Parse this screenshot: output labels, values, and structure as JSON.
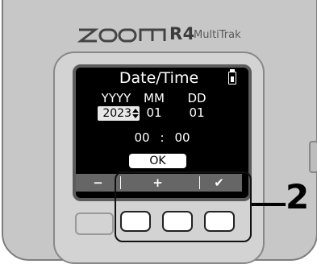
{
  "device": {
    "brand_logo": "ZOOM",
    "model": "R4",
    "subtitle": "MultiTrak"
  },
  "screen": {
    "title": "Date/Time",
    "battery_icon": "battery-icon",
    "labels": {
      "year": "YYYY",
      "month": "MM",
      "day": "DD"
    },
    "values": {
      "year": "2023",
      "month": "01",
      "day": "01",
      "hour": "00",
      "separator": ":",
      "minute": "00"
    },
    "ok_label": "OK",
    "softkeys": [
      "−",
      "+",
      "✔"
    ]
  },
  "callout": {
    "number": "2"
  },
  "colors": {
    "device_body": "#c7c7c7",
    "screen_bg": "#000000",
    "selection_bg": "#e8e8e8",
    "softkey_bar": "#666666"
  }
}
